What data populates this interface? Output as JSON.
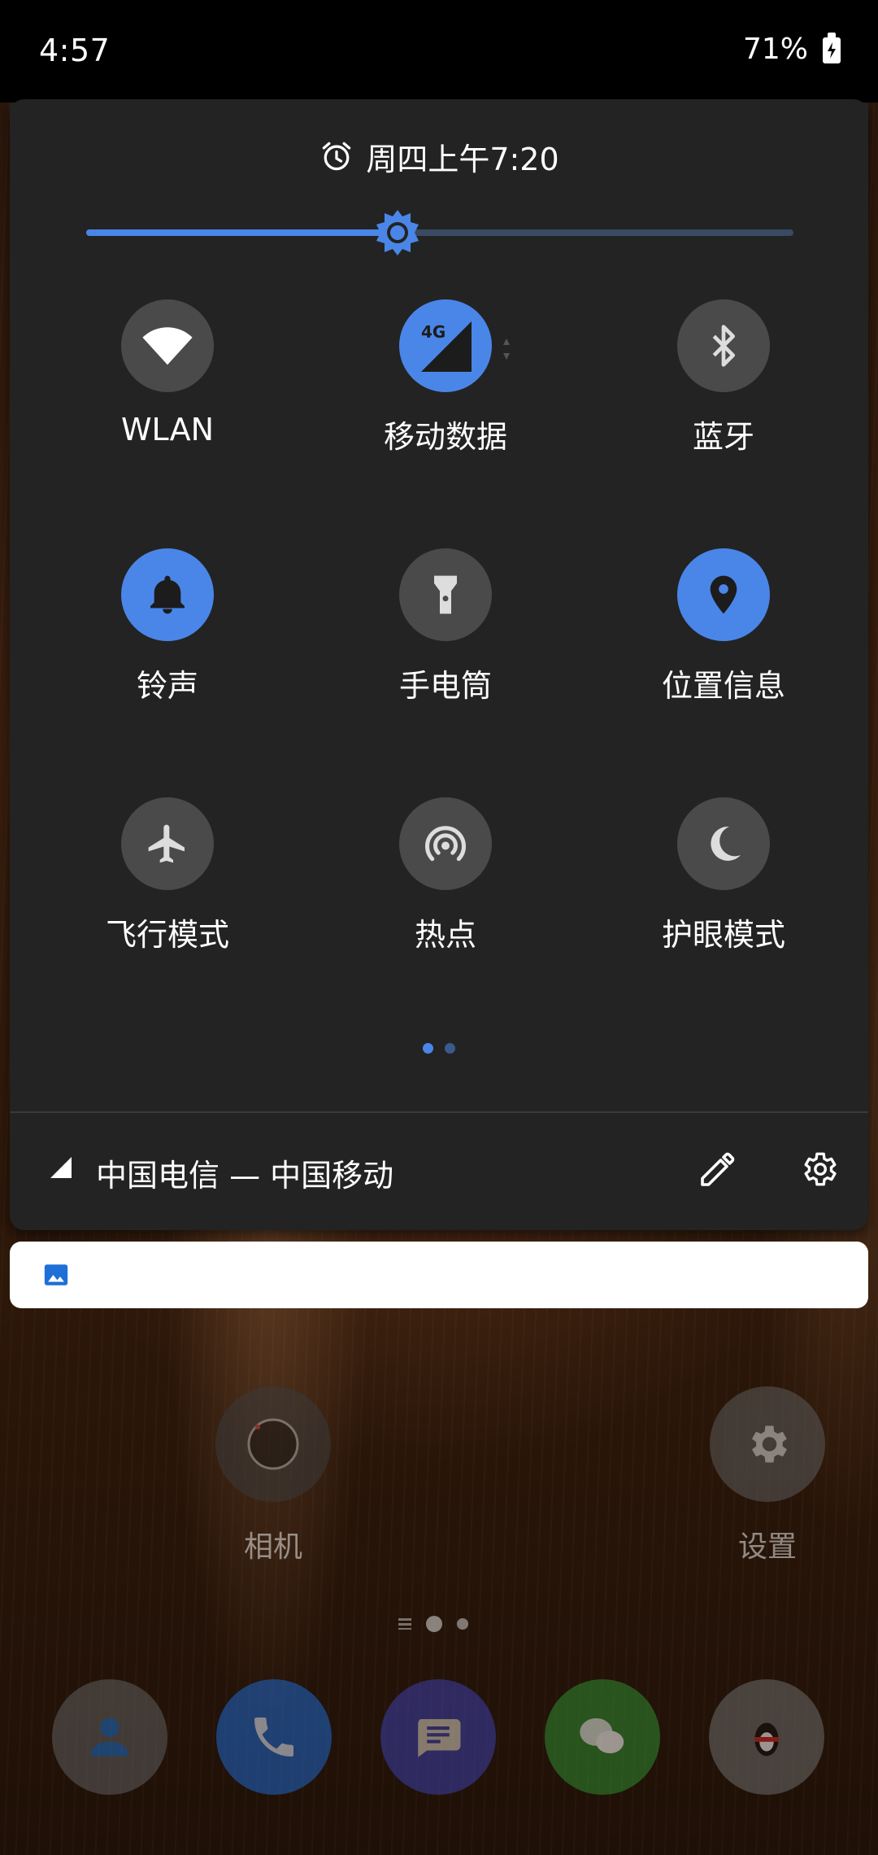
{
  "status_bar": {
    "time": "4:57",
    "battery": "71%"
  },
  "quick_settings": {
    "alarm_text": "周四上午7:20",
    "brightness_level": 0.44,
    "tiles": [
      {
        "label": "WLAN",
        "icon": "wifi-icon",
        "active": false
      },
      {
        "label": "移动数据",
        "icon": "mobile-data-4g-icon",
        "active": true
      },
      {
        "label": "蓝牙",
        "icon": "bluetooth-icon",
        "active": false
      },
      {
        "label": "铃声",
        "icon": "bell-icon",
        "active": true
      },
      {
        "label": "手电筒",
        "icon": "flashlight-icon",
        "active": false
      },
      {
        "label": "位置信息",
        "icon": "location-pin-icon",
        "active": true
      },
      {
        "label": "飞行模式",
        "icon": "airplane-icon",
        "active": false
      },
      {
        "label": "热点",
        "icon": "hotspot-icon",
        "active": false
      },
      {
        "label": "护眼模式",
        "icon": "moon-icon",
        "active": false
      }
    ],
    "mobile_badge": "4G",
    "page_index": 1,
    "page_count": 2,
    "carrier": "中国电信 — 中国移动"
  },
  "home": {
    "apps": [
      {
        "label": "相机",
        "icon": "camera-icon"
      },
      {
        "label": "设置",
        "icon": "settings-gear-icon"
      }
    ],
    "dock": [
      {
        "icon": "contacts-icon"
      },
      {
        "icon": "phone-icon"
      },
      {
        "icon": "messages-icon"
      },
      {
        "icon": "wechat-icon"
      },
      {
        "icon": "qq-penguin-icon"
      }
    ]
  },
  "colors": {
    "accent": "#4a86e8",
    "panel": "#232323",
    "tile_off": "#4a4a4a"
  }
}
